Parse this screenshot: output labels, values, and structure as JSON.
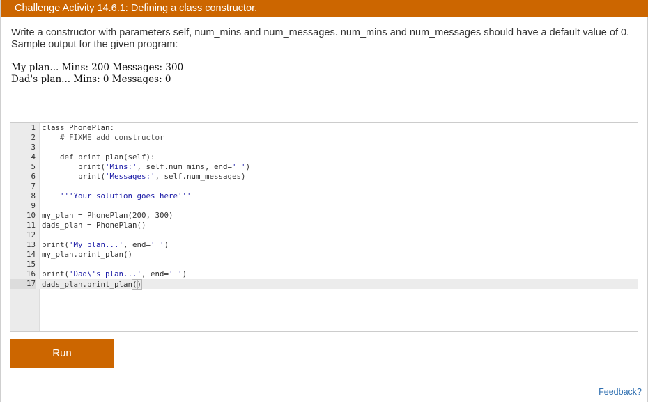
{
  "header": {
    "title": "Challenge Activity 14.6.1: Defining a class constructor."
  },
  "instructions": {
    "text": "Write a constructor with parameters self, num_mins and num_messages. num_mins and num_messages should have a default value of 0. Sample output for the given program:"
  },
  "sample_output": {
    "line1": "My plan... Mins: 200 Messages: 300",
    "line2": "Dad's plan... Mins: 0 Messages: 0"
  },
  "editor": {
    "active_line": 17,
    "lines": [
      {
        "n": "1",
        "code": "class PhonePlan:"
      },
      {
        "n": "2",
        "code": "    # FIXME add constructor"
      },
      {
        "n": "3",
        "code": ""
      },
      {
        "n": "4",
        "code": "    def print_plan(self):"
      },
      {
        "n": "5",
        "code": "        print('Mins:', self.num_mins, end=' ')"
      },
      {
        "n": "6",
        "code": "        print('Messages:', self.num_messages)"
      },
      {
        "n": "7",
        "code": ""
      },
      {
        "n": "8",
        "code": "    '''Your solution goes here'''"
      },
      {
        "n": "9",
        "code": ""
      },
      {
        "n": "10",
        "code": "my_plan = PhonePlan(200, 300)"
      },
      {
        "n": "11",
        "code": "dads_plan = PhonePlan()"
      },
      {
        "n": "12",
        "code": ""
      },
      {
        "n": "13",
        "code": "print('My plan...', end=' ')"
      },
      {
        "n": "14",
        "code": "my_plan.print_plan()"
      },
      {
        "n": "15",
        "code": ""
      },
      {
        "n": "16",
        "code": "print('Dad\\'s plan...', end=' ')"
      },
      {
        "n": "17",
        "code": "dads_plan.print_plan()"
      }
    ]
  },
  "run_button": {
    "label": "Run"
  },
  "feedback_link": {
    "label": "Feedback?"
  },
  "colors": {
    "accent": "#cc6600",
    "link": "#2f6fb0",
    "string": "#1a1aa6"
  }
}
